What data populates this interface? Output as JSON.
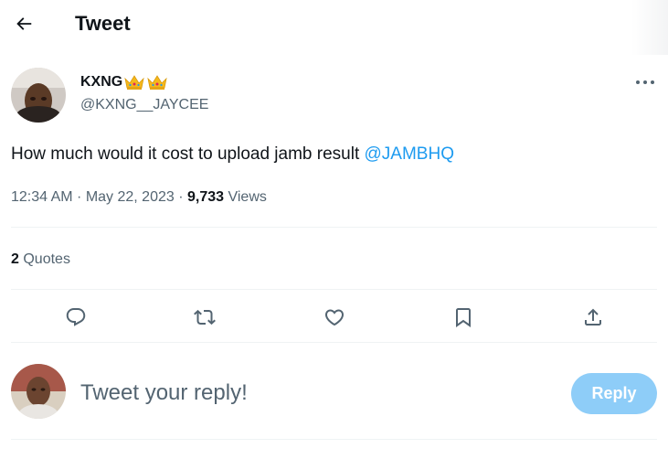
{
  "header": {
    "title": "Tweet"
  },
  "author": {
    "display_name": "KXNG",
    "handle": "@KXNG__JAYCEE"
  },
  "tweet": {
    "text": "How much would it cost to upload jamb result ",
    "mention": "@JAMBHQ",
    "time": "12:34 AM · May 22, 2023 · ",
    "views_count": "9,733",
    "views_label": " Views"
  },
  "stats": {
    "quotes_count": "2",
    "quotes_label": " Quotes"
  },
  "actions": [
    "reply-icon",
    "retweet-icon",
    "like-icon",
    "bookmark-icon",
    "share-icon"
  ],
  "reply": {
    "placeholder": "Tweet your reply!",
    "button_label": "Reply"
  },
  "colors": {
    "accent": "#1d9bf0",
    "reply_button": "#8ecdf8",
    "secondary_text": "#536471"
  }
}
